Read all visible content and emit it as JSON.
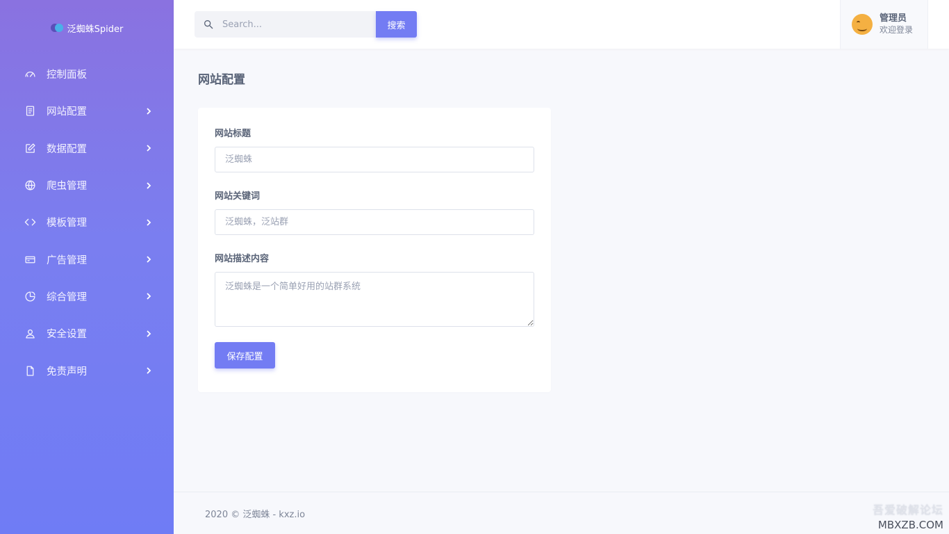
{
  "brand": {
    "name": "泛蜘蛛Spider"
  },
  "sidebar": {
    "items": [
      {
        "label": "控制面板",
        "icon": "dashboard-icon",
        "has_children": false
      },
      {
        "label": "网站配置",
        "icon": "document-icon",
        "has_children": true
      },
      {
        "label": "数据配置",
        "icon": "edit-icon",
        "has_children": true
      },
      {
        "label": "爬虫管理",
        "icon": "globe-icon",
        "has_children": true
      },
      {
        "label": "模板管理",
        "icon": "code-icon",
        "has_children": true
      },
      {
        "label": "广告管理",
        "icon": "card-icon",
        "has_children": true
      },
      {
        "label": "综合管理",
        "icon": "pie-icon",
        "has_children": true
      },
      {
        "label": "安全设置",
        "icon": "user-icon",
        "has_children": true
      },
      {
        "label": "免责声明",
        "icon": "file-icon",
        "has_children": true
      }
    ]
  },
  "header": {
    "search_placeholder": "Search...",
    "search_button": "搜索",
    "user_name": "管理员",
    "user_greeting": "欢迎登录"
  },
  "main": {
    "title": "网站配置",
    "form": {
      "site_title_label": "网站标题",
      "site_title_placeholder": "泛蜘蛛",
      "keywords_label": "网站关键词",
      "keywords_placeholder": "泛蜘蛛，泛站群",
      "description_label": "网站描述内容",
      "description_placeholder": "泛蜘蛛是一个简单好用的站群系统",
      "save_button": "保存配置"
    }
  },
  "footer": {
    "text": "2020 © 泛蜘蛛 - kxz.io"
  },
  "watermark": {
    "line1": "吾爱破解论坛",
    "line2": "MBXZB.COM"
  },
  "colors": {
    "accent": "#737cf3",
    "sidebar_top": "#8a72e0",
    "sidebar_bottom": "#6f7cf5"
  }
}
